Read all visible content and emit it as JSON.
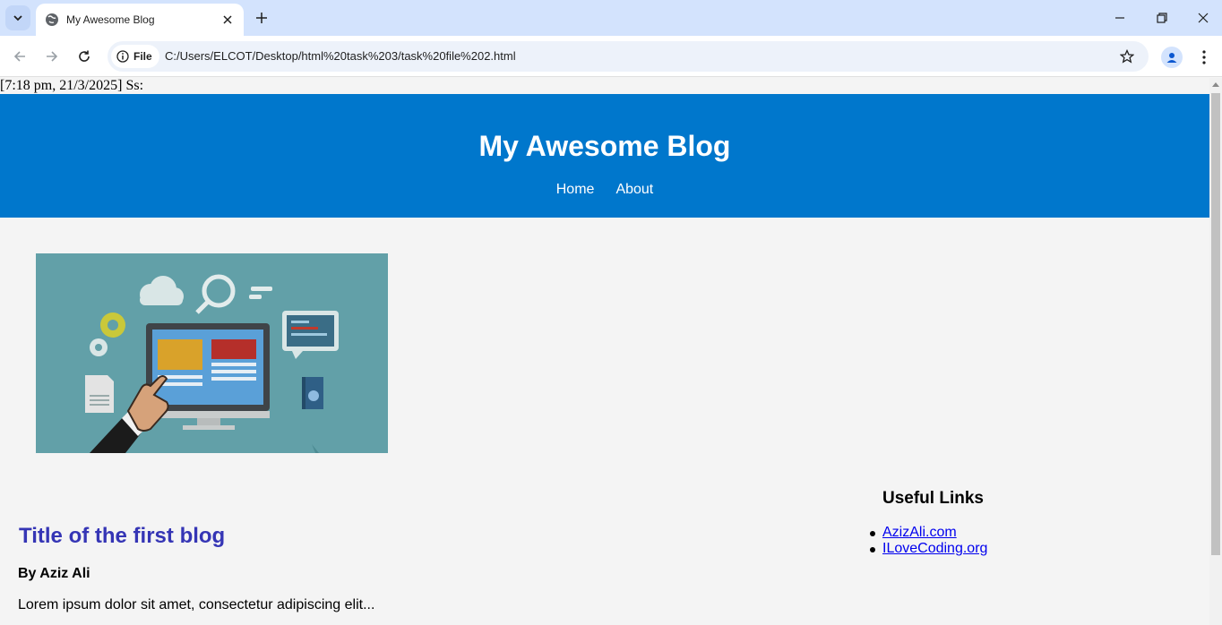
{
  "browser": {
    "tab_title": "My Awesome Blog",
    "url_scheme_label": "File",
    "url": "C:/Users/ELCOT/Desktop/html%20task%203/task%20file%202.html"
  },
  "page": {
    "stamp": "[7:18 pm, 21/3/2025] Ss:",
    "site_title": "My Awesome Blog",
    "nav": [
      {
        "label": "Home"
      },
      {
        "label": "About"
      }
    ],
    "post": {
      "title": "Title of the first blog",
      "author": "By Aziz Ali",
      "excerpt": "Lorem ipsum dolor sit amet, consectetur adipiscing elit..."
    },
    "sidebar": {
      "title": "Useful Links",
      "links": [
        {
          "label": "AzizAli.com"
        },
        {
          "label": "ILoveCoding.org"
        }
      ]
    }
  },
  "colors": {
    "header_bg": "#0077cc",
    "post_title": "#3535b5",
    "link": "#0000ee",
    "hero_bg": "#62a0a8"
  }
}
